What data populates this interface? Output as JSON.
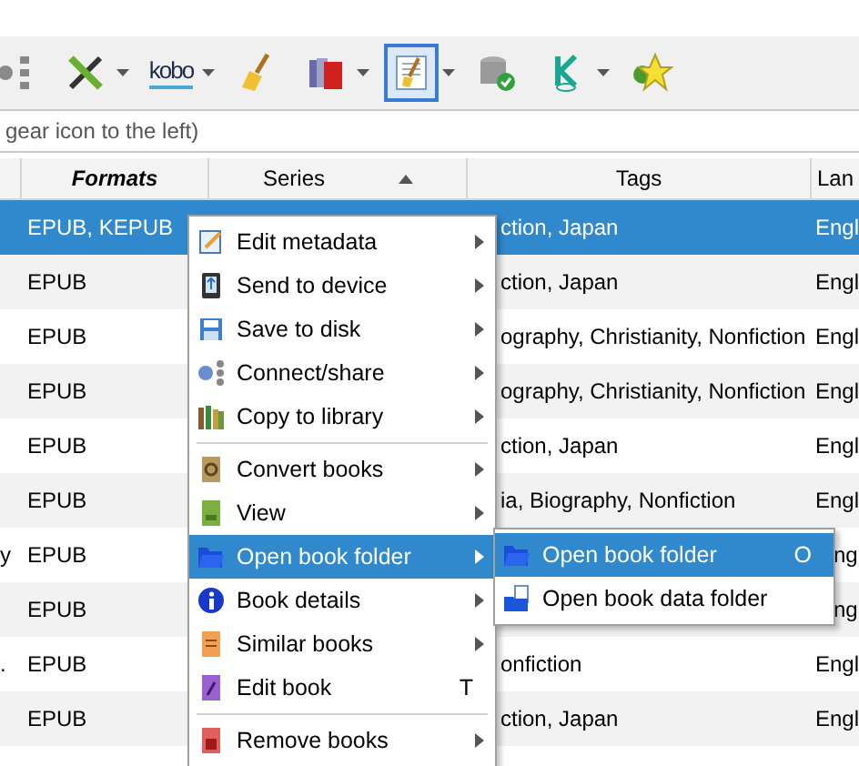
{
  "toolbar": {
    "items": [
      {
        "kind": "tree",
        "dropdown": false,
        "selected": false
      },
      {
        "kind": "tools",
        "dropdown": true,
        "selected": false
      },
      {
        "kind": "kobo",
        "label": "kobo",
        "dropdown": true,
        "selected": false
      },
      {
        "kind": "broom",
        "dropdown": false,
        "selected": false
      },
      {
        "kind": "books",
        "dropdown": true,
        "selected": false
      },
      {
        "kind": "polish",
        "dropdown": true,
        "selected": true
      },
      {
        "kind": "database",
        "dropdown": false,
        "selected": false
      },
      {
        "kind": "k",
        "dropdown": true,
        "selected": false
      },
      {
        "kind": "star",
        "dropdown": false,
        "selected": false
      }
    ]
  },
  "search": {
    "placeholder": "gear icon to the left)"
  },
  "table": {
    "columns": [
      {},
      {
        "label": "Formats",
        "bold": true,
        "sorted": false
      },
      {
        "label": "Series",
        "bold": false,
        "sorted": true
      },
      {
        "label": "Tags",
        "bold": false,
        "sorted": false
      },
      {
        "label": "Lan",
        "bold": false
      }
    ],
    "rows": [
      {
        "selected": true,
        "formats": "EPUB, KEPUB",
        "tags": "ction, Japan",
        "lang": "Engl"
      },
      {
        "selected": false,
        "formats": "EPUB",
        "tags": "ction, Japan",
        "lang": "Engl"
      },
      {
        "selected": false,
        "formats": "EPUB",
        "tags": "ography, Christianity, Nonfiction",
        "lang": "Engl"
      },
      {
        "selected": false,
        "formats": "EPUB",
        "tags": "ography, Christianity, Nonfiction",
        "lang": "Engl"
      },
      {
        "selected": false,
        "formats": "EPUB",
        "tags": "ction, Japan",
        "lang": "Engl"
      },
      {
        "selected": false,
        "formats": "EPUB",
        "tags": "ia, Biography, Nonfiction",
        "lang": "Engl"
      },
      {
        "selected": false,
        "column_1": "y",
        "formats": "EPUB",
        "lang": "ngl"
      },
      {
        "selected": false,
        "formats": "EPUB",
        "lang": "ngl"
      },
      {
        "selected": false,
        "column_1": ".",
        "formats": "EPUB",
        "tags": "onfiction",
        "lang": "Engl"
      },
      {
        "selected": false,
        "formats": "EPUB",
        "tags": "ction, Japan",
        "lang": "Engl"
      }
    ]
  },
  "context_menu": {
    "items": [
      {
        "kind": "item",
        "label": "Edit metadata",
        "submenu": true,
        "selected": false
      },
      {
        "kind": "item",
        "label": "Send to device",
        "submenu": true,
        "selected": false
      },
      {
        "kind": "item",
        "label": "Save to disk",
        "submenu": true,
        "selected": false
      },
      {
        "kind": "item",
        "label": "Connect/share",
        "submenu": true,
        "selected": false
      },
      {
        "kind": "item",
        "label": "Copy to library",
        "submenu": true,
        "selected": false
      },
      {
        "kind": "separator"
      },
      {
        "kind": "item",
        "label": "Convert books",
        "submenu": true,
        "selected": false
      },
      {
        "kind": "item",
        "label": "View",
        "submenu": true,
        "selected": false
      },
      {
        "kind": "item",
        "label": "Open book folder",
        "submenu": true,
        "selected": true
      },
      {
        "kind": "item",
        "label": "Book details",
        "submenu": true,
        "selected": false
      },
      {
        "kind": "item",
        "label": "Similar books",
        "submenu": true,
        "selected": false
      },
      {
        "kind": "item",
        "label": "Edit book",
        "shortcut": "T",
        "submenu": false,
        "selected": false
      },
      {
        "kind": "separator"
      },
      {
        "kind": "item",
        "label": "Remove books",
        "submenu": true,
        "selected": false
      }
    ]
  },
  "submenu": {
    "items": [
      {
        "label": "Open book folder",
        "shortcut": "O",
        "selected": true
      },
      {
        "label": "Open book data folder",
        "selected": false
      }
    ]
  }
}
